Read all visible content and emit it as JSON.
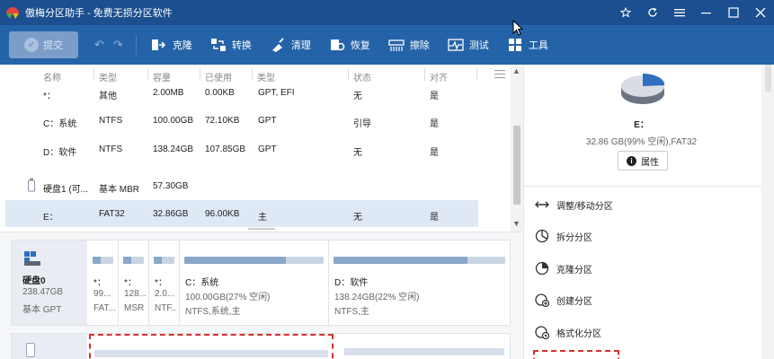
{
  "titlebar": {
    "title": "傲梅分区助手 - 免费无损分区软件",
    "icons": [
      "star-icon",
      "refresh-icon",
      "menu-icon",
      "minimize-icon",
      "maximize-icon",
      "close-icon"
    ]
  },
  "toolbar": {
    "commit_label": "提交",
    "items": [
      {
        "label": "克隆",
        "icon": "clone-icon"
      },
      {
        "label": "转换",
        "icon": "convert-icon"
      },
      {
        "label": "清理",
        "icon": "clean-icon"
      },
      {
        "label": "恢复",
        "icon": "recover-icon"
      },
      {
        "label": "擦除",
        "icon": "wipe-icon"
      },
      {
        "label": "测试",
        "icon": "test-icon"
      },
      {
        "label": "工具",
        "icon": "tools-icon"
      }
    ]
  },
  "table": {
    "headers": [
      "名称",
      "类型",
      "容量",
      "已使用",
      "类型",
      "状态",
      "对齐"
    ],
    "rows": [
      {
        "name": "*：",
        "type": "其他",
        "capacity": "2.00MB",
        "used": "0.00KB",
        "ptype": "GPT, EFI",
        "status": "无",
        "align": "是"
      },
      {
        "name": "C：系统",
        "type": "NTFS",
        "capacity": "100.00GB",
        "used": "72.10KB",
        "ptype": "GPT",
        "status": "引导",
        "align": "是"
      },
      {
        "name": "D：软件",
        "type": "NTFS",
        "capacity": "138.24GB",
        "used": "107.85GB",
        "ptype": "GPT",
        "status": "无",
        "align": "是"
      },
      {
        "name": "硬盘1 (可...",
        "type": "基本 MBR",
        "capacity": "57.30GB",
        "used": "",
        "ptype": "",
        "status": "",
        "align": ""
      },
      {
        "name": "E：",
        "type": "FAT32",
        "capacity": "32.86GB",
        "used": "96.00KB",
        "ptype": "主",
        "status": "无",
        "align": "是"
      }
    ]
  },
  "disk0": {
    "name": "硬盘0",
    "size": "238.47GB",
    "type": "基本 GPT",
    "partitions": [
      {
        "name": "*：",
        "info": "99...",
        "fs": "FAT...",
        "fill_pct": 40
      },
      {
        "name": "*：",
        "info": "128...",
        "fs": "MSR",
        "fill_pct": 40
      },
      {
        "name": "*：",
        "info": "2.0...",
        "fs": "NTF...",
        "fill_pct": 40
      },
      {
        "name": "C：系统",
        "info": "100.00GB(27% 空闲)",
        "fs": "NTFS,系统,主",
        "fill_pct": 73
      },
      {
        "name": "D：软件",
        "info": "138.24GB(22% 空闲)",
        "fs": "NTFS,主",
        "fill_pct": 78
      }
    ]
  },
  "side": {
    "selected_name": "E：",
    "selected_info": "32.86 GB(99% 空闲),FAT32",
    "properties_label": "属性",
    "operations": [
      {
        "label": "调整/移动分区",
        "icon": "resize-move-icon"
      },
      {
        "label": "拆分分区",
        "icon": "split-icon"
      },
      {
        "label": "克隆分区",
        "icon": "clone-partition-icon"
      },
      {
        "label": "创建分区",
        "icon": "create-partition-icon"
      },
      {
        "label": "格式化分区",
        "icon": "format-icon"
      }
    ]
  }
}
